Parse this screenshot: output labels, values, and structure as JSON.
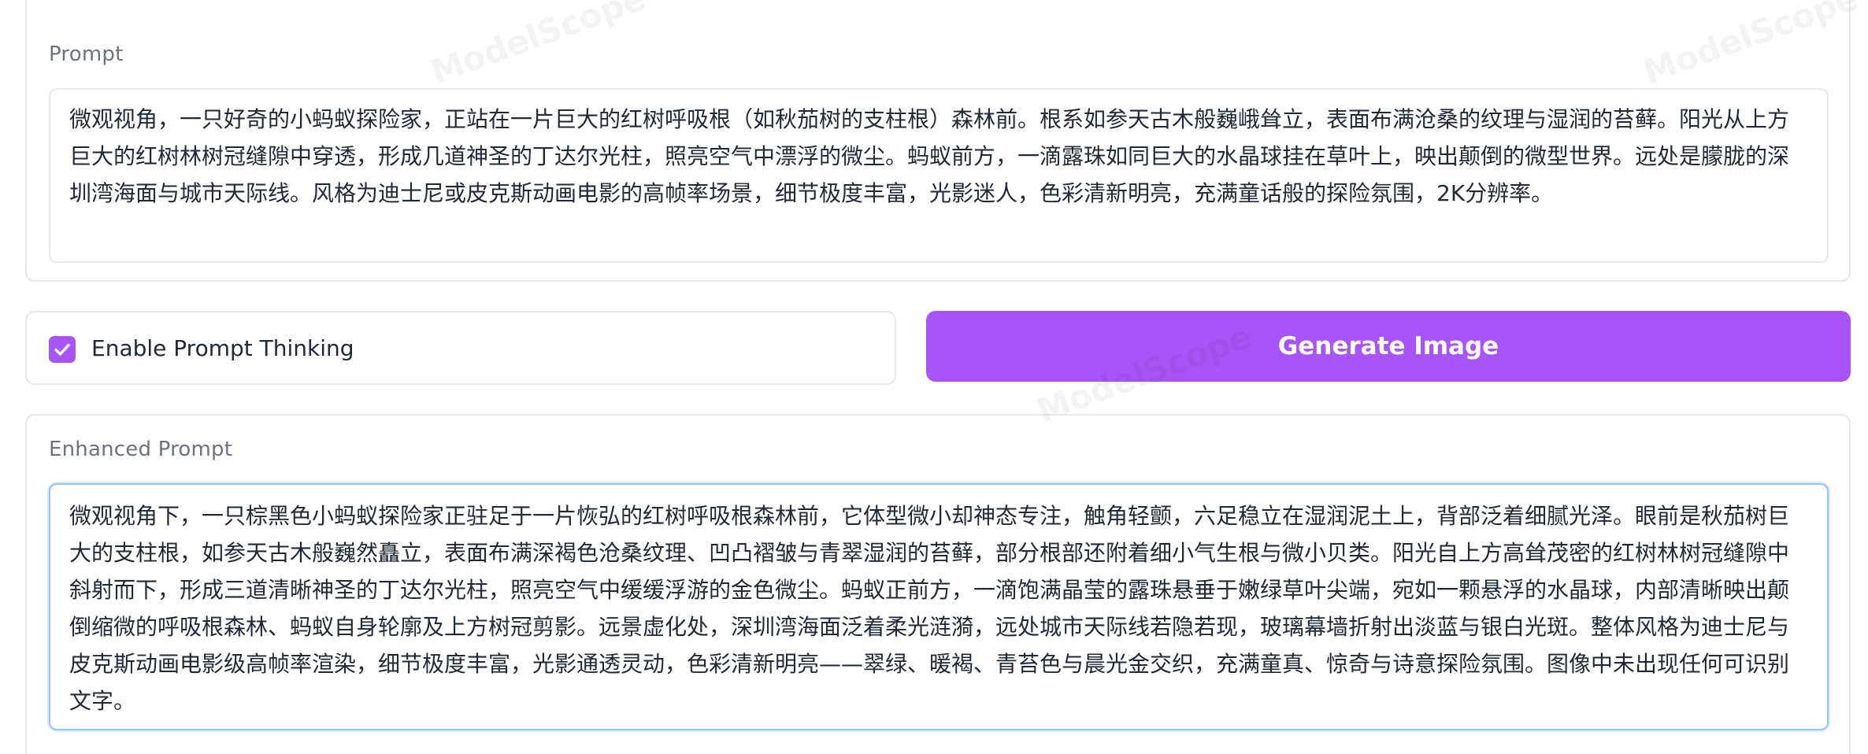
{
  "prompt": {
    "label": "Prompt",
    "value": "微观视角，一只好奇的小蚂蚁探险家，正站在一片巨大的红树呼吸根（如秋茄树的支柱根）森林前。根系如参天古木般巍峨耸立，表面布满沧桑的纹理与湿润的苔藓。阳光从上方巨大的红树林树冠缝隙中穿透，形成几道神圣的丁达尔光柱，照亮空气中漂浮的微尘。蚂蚁前方，一滴露珠如同巨大的水晶球挂在草叶上，映出颠倒的微型世界。远处是朦胧的深圳湾海面与城市天际线。风格为迪士尼或皮克斯动画电影的高帧率场景，细节极度丰富，光影迷人，色彩清新明亮，充满童话般的探险氛围，2K分辨率。"
  },
  "options": {
    "prompt_thinking_label": "Enable Prompt Thinking",
    "prompt_thinking_checked": true
  },
  "actions": {
    "generate_label": "Generate Image"
  },
  "enhanced": {
    "label": "Enhanced Prompt",
    "value": "微观视角下，一只棕黑色小蚂蚁探险家正驻足于一片恢弘的红树呼吸根森林前，它体型微小却神态专注，触角轻颤，六足稳立在湿润泥土上，背部泛着细腻光泽。眼前是秋茄树巨大的支柱根，如参天古木般巍然矗立，表面布满深褐色沧桑纹理、凹凸褶皱与青翠湿润的苔藓，部分根部还附着细小气生根与微小贝类。阳光自上方高耸茂密的红树林树冠缝隙中斜射而下，形成三道清晰神圣的丁达尔光柱，照亮空气中缓缓浮游的金色微尘。蚂蚁正前方，一滴饱满晶莹的露珠悬垂于嫩绿草叶尖端，宛如一颗悬浮的水晶球，内部清晰映出颠倒缩微的呼吸根森林、蚂蚁自身轮廓及上方树冠剪影。远景虚化处，深圳湾海面泛着柔光涟漪，远处城市天际线若隐若现，玻璃幕墙折射出淡蓝与银白光斑。整体风格为迪士尼与皮克斯动画电影级高帧率渲染，细节极度丰富，光影通透灵动，色彩清新明亮——翠绿、暖褐、青苔色与晨光金交织，充满童真、惊奇与诗意探险氛围。图像中未出现任何可识别文字。"
  },
  "theme": {
    "accent": "#a855f7",
    "focus_border": "#93c5fd",
    "panel_border": "#e5e7eb"
  },
  "watermark": "ModelScope"
}
